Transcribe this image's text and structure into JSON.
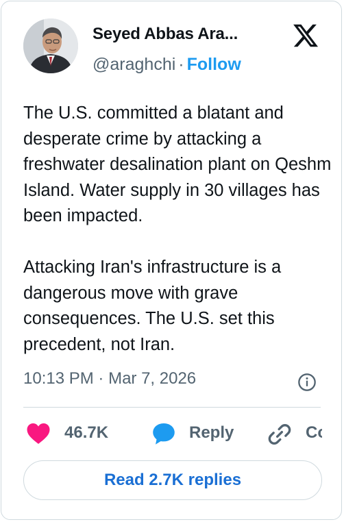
{
  "author": {
    "name": "Seyed Abbas Ara...",
    "handle": "@araghchi",
    "separator": "·",
    "follow_label": "Follow"
  },
  "tweet": {
    "text": "The U.S. committed a blatant and desperate crime by attacking a freshwater desalination plant on Qeshm Island. Water supply in 30 villages has been impacted.\n\nAttacking Iran's infrastructure is a dangerous move with grave consequences. The U.S. set this precedent, not Iran.",
    "time": "10:13 PM",
    "separator": "·",
    "date": "Mar 7, 2026"
  },
  "actions": {
    "likes": "46.7K",
    "reply_label": "Reply",
    "copy_label": "Copy link"
  },
  "read_replies_label": "Read 2.7K replies",
  "icons": {
    "logo": "x-logo-icon",
    "info": "info-icon",
    "like": "heart-icon",
    "reply": "speech-bubble-icon",
    "copy": "link-icon"
  },
  "colors": {
    "text": "#0f1419",
    "secondary": "#536471",
    "follow": "#1d9bf0",
    "heart": "#f91880",
    "reply_icon": "#1d9bf0",
    "button_text": "#1a6fd4",
    "border": "#cfd9de"
  }
}
